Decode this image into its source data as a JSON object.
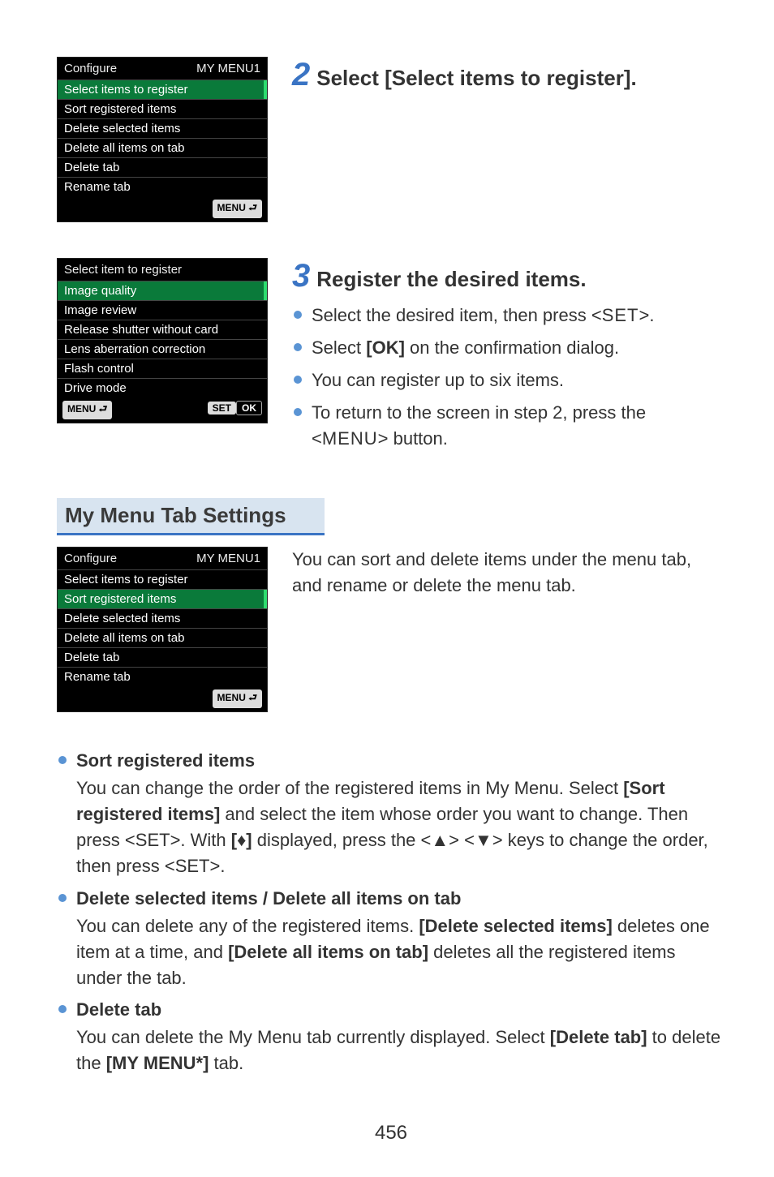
{
  "lcd1": {
    "title_left": "Configure",
    "title_right": "MY MENU1",
    "rows": [
      "Select items to register",
      "Sort registered items",
      "Delete selected items",
      "Delete all items on tab",
      "Delete tab",
      "Rename tab"
    ],
    "footer_right": "MENU ⮐"
  },
  "lcd2": {
    "title": "Select item to register",
    "rows": [
      "Image quality",
      "Image review",
      "Release shutter without card",
      "Lens aberration correction",
      "Flash control",
      "Drive mode"
    ],
    "footer_left": "MENU ⮐",
    "footer_right_a": "SET",
    "footer_right_b": "OK"
  },
  "lcd3": {
    "title_left": "Configure",
    "title_right": "MY MENU1",
    "rows": [
      "Select items to register",
      "Sort registered items",
      "Delete selected items",
      "Delete all items on tab",
      "Delete tab",
      "Rename tab"
    ],
    "footer_right": "MENU ⮐"
  },
  "step2": {
    "num": "2",
    "title": "Select [Select items to register]."
  },
  "step3": {
    "num": "3",
    "title": "Register the desired items.",
    "b1a": "Select the desired item, then press <",
    "b1b": "SET",
    "b1c": ">.",
    "b2a": "Select ",
    "b2b": "[OK]",
    "b2c": " on the confirmation dialog.",
    "b3": "You can register up to six items.",
    "b4a": "To return to the screen in step 2, press the <",
    "b4b": "MENU",
    "b4c": "> button."
  },
  "heading": "My Menu Tab Settings",
  "intro": "You can sort and delete items under the menu tab, and rename or delete the menu tab.",
  "sort": {
    "head": "Sort registered items",
    "t1": "You can change the order of the registered items in My Menu. Select ",
    "t2": "[Sort registered items]",
    "t3": " and select the item whose order you want to change. Then press <",
    "t4": "SET",
    "t5": ">. With ",
    "t6": "[♦]",
    "t7": " displayed, press the <",
    "t8": "▲",
    "t9": "> <",
    "t10": "▼",
    "t11": "> keys to change the order, then press <",
    "t12": "SET",
    "t13": ">."
  },
  "del": {
    "head": "Delete selected items / Delete all items on tab",
    "t1": "You can delete any of the registered items. ",
    "t2": "[Delete selected items]",
    "t3": " deletes one item at a time, and ",
    "t4": "[Delete all items on tab]",
    "t5": " deletes all the registered items under the tab."
  },
  "deltab": {
    "head": "Delete tab",
    "t1": "You can delete the My Menu tab currently displayed. Select ",
    "t2": "[Delete tab]",
    "t3": " to delete the ",
    "t4": "[MY MENU*]",
    "t5": " tab."
  },
  "page": "456"
}
